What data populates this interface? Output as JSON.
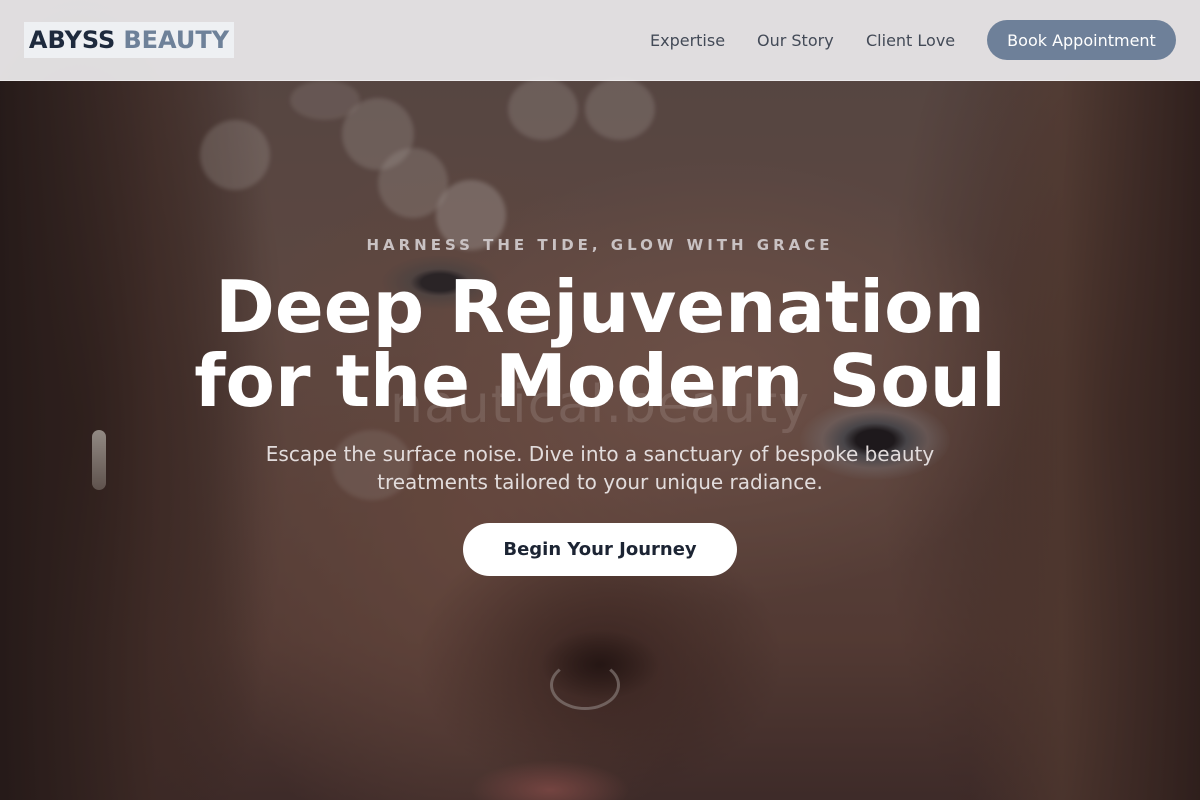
{
  "header": {
    "logo_primary": "ABYSS",
    "logo_secondary": "BEAUTY",
    "nav": [
      {
        "label": "Expertise"
      },
      {
        "label": "Our Story"
      },
      {
        "label": "Client Love"
      }
    ],
    "cta_label": "Book Appointment"
  },
  "hero": {
    "eyebrow": "HARNESS THE TIDE, GLOW WITH GRACE",
    "headline_line1": "Deep Rejuvenation",
    "headline_line2": "for the Modern Soul",
    "subline_line1": "Escape the surface noise. Dive into a sanctuary of bespoke beauty",
    "subline_line2": "treatments tailored to your unique radiance.",
    "button_label": "Begin Your Journey",
    "watermark": "nautical.beauty"
  },
  "colors": {
    "brand_dark": "#1e2a3d",
    "brand_accent": "#6e8199",
    "cta_background": "#6e8099",
    "hero_button_background": "#ffffff"
  }
}
